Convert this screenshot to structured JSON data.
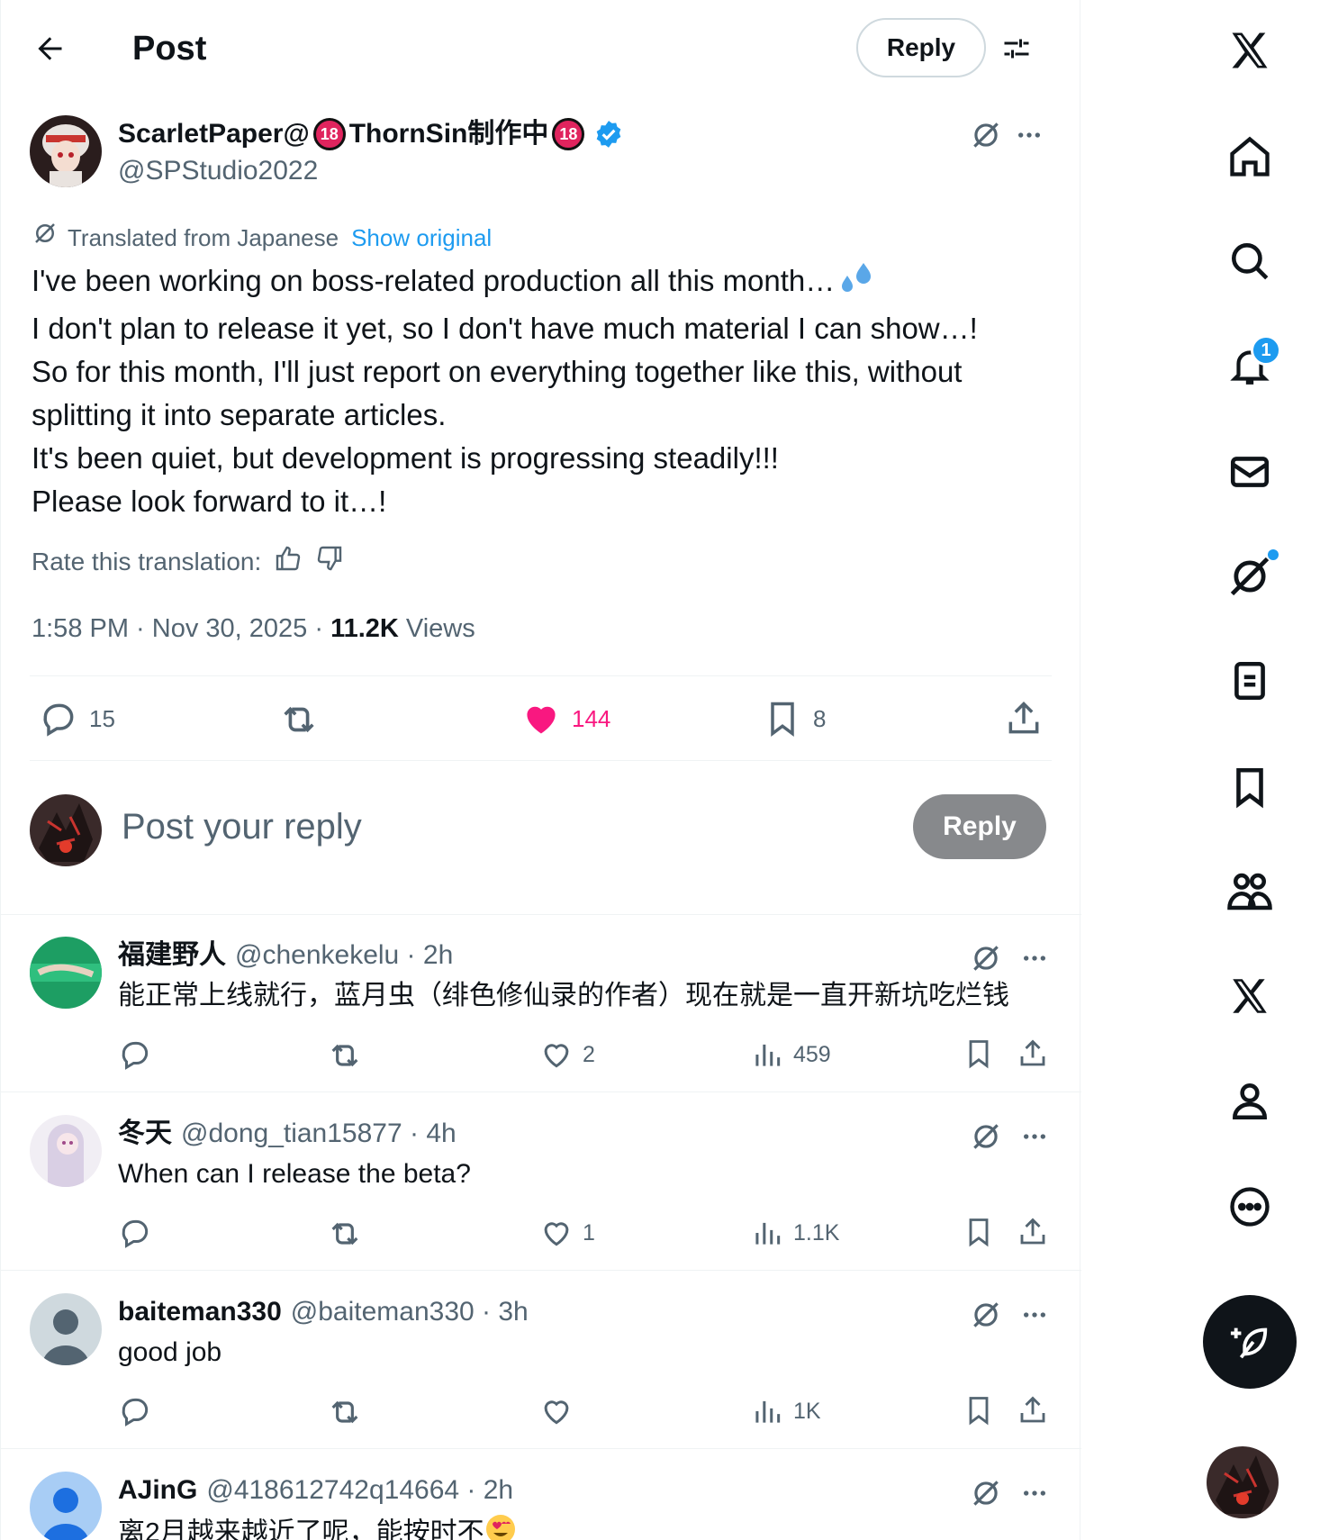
{
  "header": {
    "title": "Post",
    "reply_label": "Reply"
  },
  "post": {
    "author_name": "ScarletPaper@",
    "author_name_mid": "ThornSin制作中",
    "age_badge": "18",
    "handle": "@SPStudio2022",
    "translated_label": "Translated from Japanese",
    "show_original": "Show original",
    "lines": [
      "I've been working on boss-related production all this month…",
      "I don't plan to release it yet, so I don't have much material I can show…!",
      "So for this month, I'll just report on everything together like this, without",
      "splitting it into separate articles.",
      "It's been quiet, but development is progressing steadily!!!",
      "Please look forward to it…!"
    ],
    "rate_label": "Rate this translation:",
    "time": "1:58 PM · Nov 30, 2025 · ",
    "views_count": "11.2K",
    "views_label": " Views",
    "stats": {
      "replies": "15",
      "likes": "144",
      "bookmarks": "8"
    }
  },
  "compose": {
    "placeholder": "Post your reply",
    "button": "Reply"
  },
  "replies": [
    {
      "name": "福建野人",
      "meta": "@chenkekelu · 2h",
      "text": "能正常上线就行，蓝月虫（绯色修仙录的作者）现在就是一直开新坑吃烂钱",
      "likes": "2",
      "views": "459"
    },
    {
      "name": "冬天",
      "meta": "@dong_tian15877 · 4h",
      "text": "When can I release the beta?",
      "likes": "1",
      "views": "1.1K"
    },
    {
      "name": "baiteman330",
      "meta": "@baiteman330 · 3h",
      "text": "good job",
      "likes": "",
      "views": "1K"
    },
    {
      "name": "AJinG",
      "meta": "@418612742q14664 · 2h",
      "text": "离2月越来越近了呢，能按时不",
      "likes": "",
      "views": ""
    }
  ],
  "rail": {
    "notification_count": "1"
  },
  "colors": {
    "accent": "#1d9bf0",
    "like": "#f91880",
    "text": "#0f1419",
    "muted": "#536471"
  }
}
